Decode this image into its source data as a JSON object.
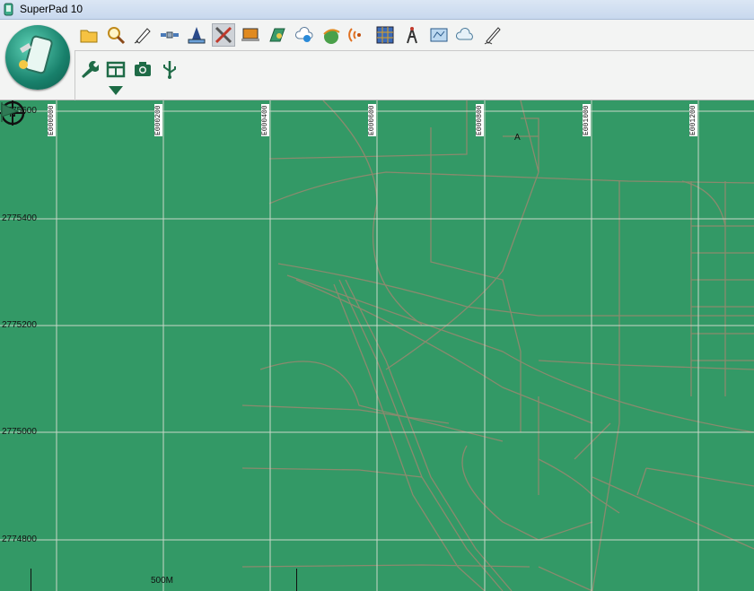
{
  "window": {
    "title": "SuperPad 10"
  },
  "toolbar": {
    "row1": [
      {
        "name": "open-folder-icon",
        "active": false
      },
      {
        "name": "search-icon",
        "active": false
      },
      {
        "name": "draw-pen-icon",
        "active": false
      },
      {
        "name": "satellite-icon",
        "active": false
      },
      {
        "name": "measure-icon",
        "active": false
      },
      {
        "name": "tools-cross-icon",
        "active": true
      },
      {
        "name": "laptop-icon",
        "active": false
      },
      {
        "name": "map-layer-icon",
        "active": false
      },
      {
        "name": "cloud-download-icon",
        "active": false
      },
      {
        "name": "globe-route-icon",
        "active": false
      },
      {
        "name": "signal-icon",
        "active": false
      },
      {
        "name": "grid-icon",
        "active": false
      },
      {
        "name": "antenna-tower-icon",
        "active": false
      },
      {
        "name": "map-panel-icon",
        "active": false
      },
      {
        "name": "cloud-icon",
        "active": false
      },
      {
        "name": "pencil-sign-icon",
        "active": false
      }
    ],
    "row2": [
      {
        "name": "wrench-icon"
      },
      {
        "name": "panel-layout-icon"
      },
      {
        "name": "camera-icon"
      },
      {
        "name": "usb-icon"
      }
    ]
  },
  "map": {
    "background_color": "#339966",
    "grid_color": "#c8d8c8",
    "road_color": "#8a8a6e",
    "x_grid_labels": [
      "E000000",
      "E000200",
      "E000400",
      "E000600",
      "E000800",
      "E001000",
      "E001200"
    ],
    "y_grid_labels": [
      "2775600",
      "2775400",
      "2775200",
      "2775000",
      "2774800"
    ],
    "scale_label": "500M",
    "poi_label": "A"
  }
}
